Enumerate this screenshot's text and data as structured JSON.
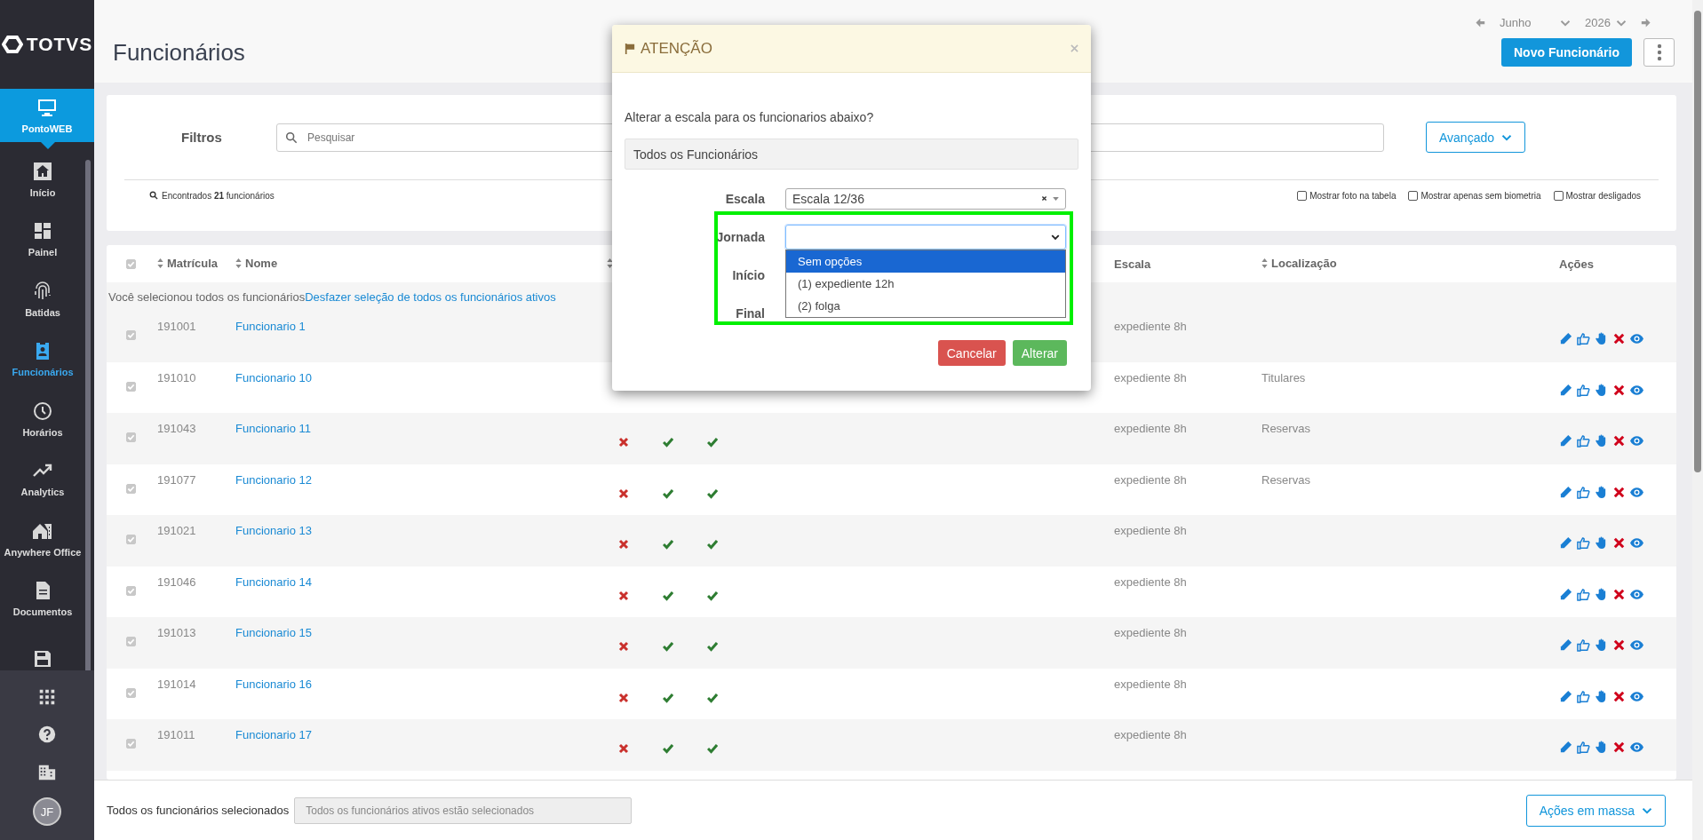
{
  "sidebar": {
    "logo": "TOTVS",
    "product": {
      "label": "PontoWEB",
      "selected": true
    },
    "items": [
      {
        "label": "Início",
        "selected": false
      },
      {
        "label": "Painel",
        "selected": false
      },
      {
        "label": "Batidas",
        "selected": false
      },
      {
        "label": "Funcionários",
        "selected": true
      },
      {
        "label": "Horários",
        "selected": false
      },
      {
        "label": "Analytics",
        "selected": false
      },
      {
        "label": "Anywhere Office",
        "selected": false
      },
      {
        "label": "Documentos",
        "selected": false
      },
      {
        "selected": false
      }
    ],
    "avatar": "JF"
  },
  "header": {
    "title": "Funcionários",
    "month": "Junho",
    "year": "2026",
    "new_button": "Novo Funcionário"
  },
  "filters": {
    "label": "Filtros",
    "search_placeholder": "Pesquisar",
    "advanced_button": "Avançado",
    "found": "Encontrados **21** funcionários",
    "options": [
      {
        "label": "Mostrar foto na tabela",
        "checked": false
      },
      {
        "label": "Mostrar apenas sem biometria",
        "checked": false
      },
      {
        "label": "Mostrar desligados",
        "checked": false
      }
    ]
  },
  "table": {
    "select_all_checked": true,
    "columns": [
      {
        "label": "Matrícula",
        "sortable": true
      },
      {
        "label": "Nome",
        "sortable": true
      },
      {
        "sortable": true
      },
      {
        "label": "Escala",
        "sortable": false
      },
      {
        "label": "Localização",
        "sortable": true
      },
      {
        "label": "Ações",
        "sortable": false
      }
    ],
    "selection_message": "Você selecionou todos os funcionários",
    "selection_link": "Desfazer seleção de todos os funcionários ativos",
    "rows": [
      {
        "checked": true,
        "id": "191001",
        "name": "Funcionario 1",
        "escala": "expediente 8h"
      },
      {
        "checked": true,
        "id": "191010",
        "name": "Funcionario 10",
        "escala": "expediente 8h",
        "location": "Titulares"
      },
      {
        "checked": true,
        "id": "191043",
        "name": "Funcionario 11",
        "flags": [
          false,
          true,
          true
        ],
        "escala": "expediente 8h",
        "location": "Reservas"
      },
      {
        "checked": true,
        "id": "191077",
        "name": "Funcionario 12",
        "flags": [
          false,
          true,
          true
        ],
        "escala": "expediente 8h",
        "location": "Reservas"
      },
      {
        "checked": true,
        "id": "191021",
        "name": "Funcionario 13",
        "flags": [
          false,
          true,
          true
        ],
        "escala": "expediente 8h"
      },
      {
        "checked": true,
        "id": "191046",
        "name": "Funcionario 14",
        "flags": [
          false,
          true,
          true
        ],
        "escala": "expediente 8h"
      },
      {
        "checked": true,
        "id": "191013",
        "name": "Funcionario 15",
        "flags": [
          false,
          true,
          true
        ],
        "escala": "expediente 8h"
      },
      {
        "checked": true,
        "id": "191014",
        "name": "Funcionario 16",
        "flags": [
          false,
          true,
          true
        ],
        "escala": "expediente 8h"
      },
      {
        "checked": true,
        "id": "191011",
        "name": "Funcionario 17",
        "flags": [
          false,
          true,
          true
        ],
        "escala": "expediente 8h"
      }
    ]
  },
  "bottom_bar": {
    "label": "Todos os funcionários selecionados",
    "value": "Todos os funcionários ativos estão selecionados",
    "button": "Ações em massa"
  },
  "modal": {
    "title": "ATENÇÃO",
    "question": "Alterar a escala para os funcionarios abaixo?",
    "target": "Todos os Funcionários",
    "fields": [
      {
        "label": "Escala",
        "kind": "select2",
        "value": "Escala 12/36"
      },
      {
        "label": "Jornada",
        "kind": "select",
        "expanded": true,
        "highlighted": true,
        "options": [
          {
            "label": "Sem opções",
            "selected": true
          },
          {
            "label": "(1) expediente 12h",
            "selected": false
          },
          {
            "label": "(2) folga",
            "selected": false
          }
        ]
      },
      {
        "label": "Início",
        "kind": "hidden"
      },
      {
        "label": "Final",
        "kind": "hidden"
      }
    ],
    "buttons": [
      {
        "label": "Cancelar",
        "kind": "danger"
      },
      {
        "label": "Alterar",
        "kind": "success"
      }
    ]
  }
}
